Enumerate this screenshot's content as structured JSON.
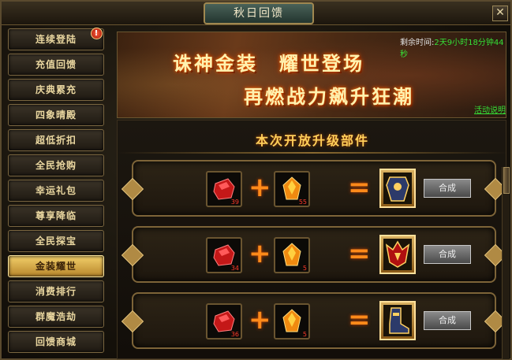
{
  "window": {
    "title": "秋日回馈",
    "close_label": "✕"
  },
  "sidebar": {
    "items": [
      {
        "label": "连续登陆",
        "badge": "!"
      },
      {
        "label": "充值回馈"
      },
      {
        "label": "庆典累充"
      },
      {
        "label": "四象晴殿"
      },
      {
        "label": "超低折扣"
      },
      {
        "label": "全民抢购"
      },
      {
        "label": "幸运礼包"
      },
      {
        "label": "尊享降临"
      },
      {
        "label": "全民探宝"
      },
      {
        "label": "金装耀世",
        "active": true
      },
      {
        "label": "消费排行"
      },
      {
        "label": "群魔浩劫"
      },
      {
        "label": "回馈商城"
      }
    ]
  },
  "banner": {
    "line1": "诛神金装　耀世登场",
    "line2": "再燃战力飙升狂潮",
    "timer_label": "剩余时间:",
    "timer_value": "2天9小时18分钟44秒",
    "rules_link": "活动说明"
  },
  "main": {
    "section_title": "本次开放升级部件",
    "plus": "+",
    "equals": "=",
    "recipes": [
      {
        "material_a": "red-gem",
        "material_a_count": "39",
        "material_b": "orange-crystal",
        "material_b_count": "55",
        "result": "golden-armor",
        "button": "合成"
      },
      {
        "material_a": "red-gem",
        "material_a_count": "34",
        "material_b": "orange-crystal",
        "material_b_count": "5",
        "result": "golden-helmet",
        "button": "合成"
      },
      {
        "material_a": "red-gem",
        "material_a_count": "36",
        "material_b": "orange-crystal",
        "material_b_count": "5",
        "result": "golden-boots",
        "button": "合成"
      }
    ]
  },
  "colors": {
    "accent_gold": "#ffcf5a",
    "active_tab": "#f2cf6a",
    "timer_green": "#36e036",
    "symbol_orange": "#ff8a1a",
    "count_red": "#ff3a2a"
  }
}
